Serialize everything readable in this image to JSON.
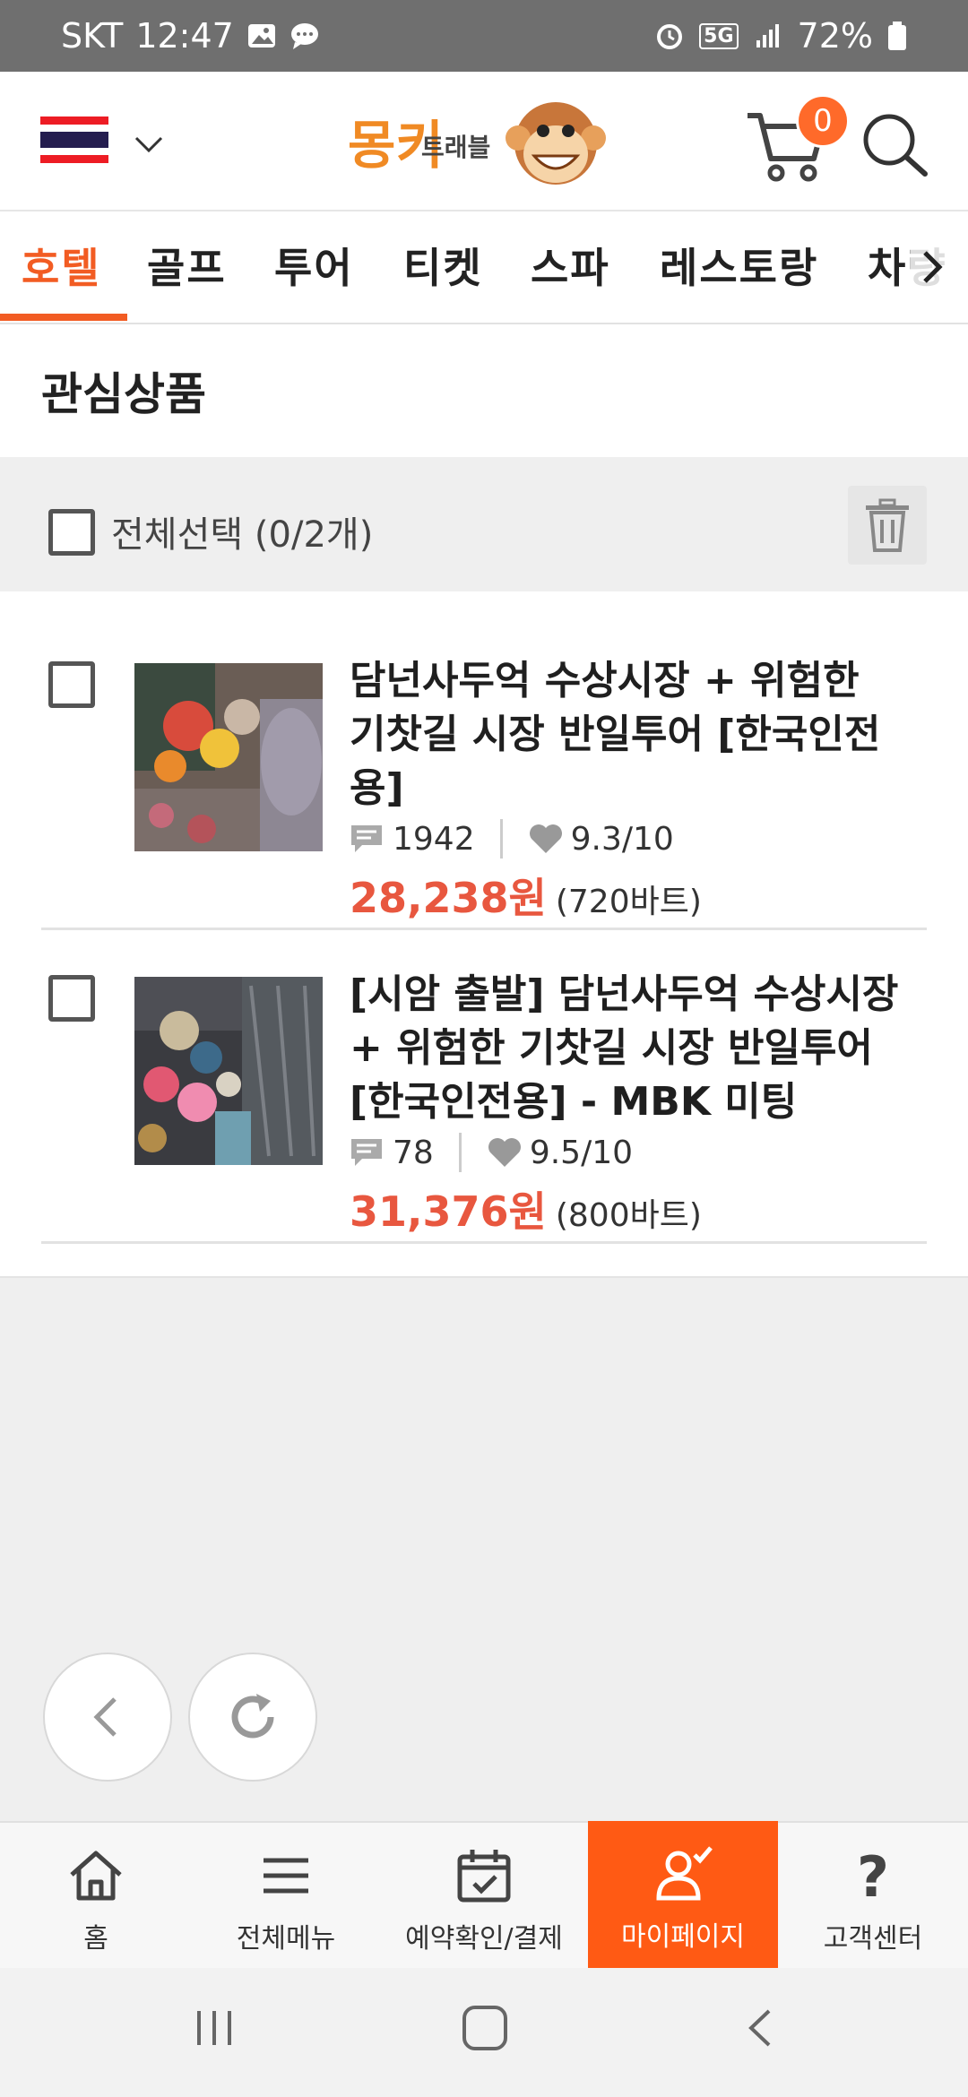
{
  "status_bar": {
    "carrier": "SKT",
    "time": "12:47",
    "network": "5G",
    "battery": "72%"
  },
  "header": {
    "logo_text": "몽키트래블",
    "cart_count": "0",
    "brand_color": "#f25c23"
  },
  "tabs": [
    {
      "label": "호텔",
      "active": true
    },
    {
      "label": "골프"
    },
    {
      "label": "투어"
    },
    {
      "label": "티켓"
    },
    {
      "label": "스파"
    },
    {
      "label": "레스토랑"
    },
    {
      "label": "차량"
    }
  ],
  "page": {
    "title": "관심상품"
  },
  "select_bar": {
    "label": "전체선택 (0/2개)"
  },
  "items": [
    {
      "title": "담넌사두억 수상시장 + 위험한 기찻길 시장 반일투어 [한국인전용]",
      "reviews": "1942",
      "rating": "9.3/10",
      "price_won": "28,238원",
      "price_baht": "(720바트)"
    },
    {
      "title": "[시암 출발] 담넌사두억 수상시장 + 위험한 기찻길 시장 반일투어 [한국인전용] - MBK 미팅",
      "reviews": "78",
      "rating": "9.5/10",
      "price_won": "31,376원",
      "price_baht": "(800바트)"
    }
  ],
  "bottom_nav": [
    {
      "label": "홈",
      "icon": "home-icon"
    },
    {
      "label": "전체메뉴",
      "icon": "menu-icon"
    },
    {
      "label": "예약확인/결제",
      "icon": "calendar-check-icon"
    },
    {
      "label": "마이페이지",
      "icon": "user-check-icon",
      "active": true
    },
    {
      "label": "고객센터",
      "icon": "question-icon"
    }
  ]
}
